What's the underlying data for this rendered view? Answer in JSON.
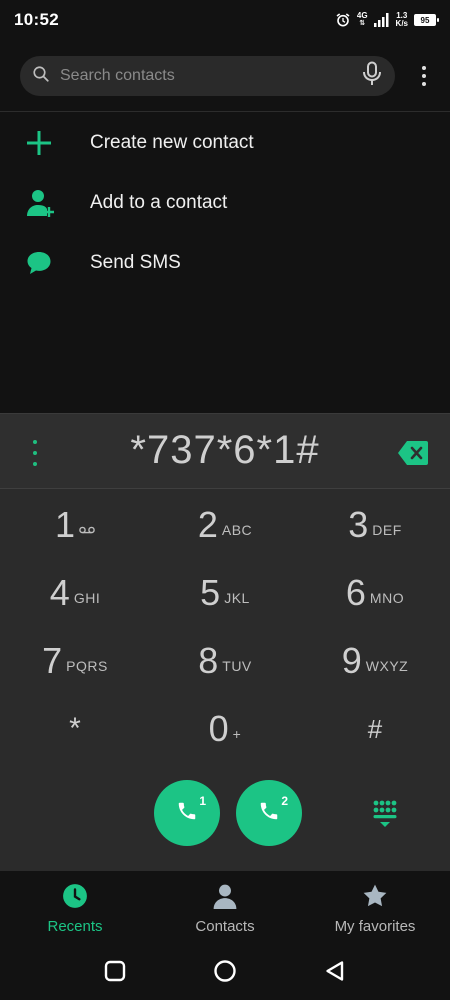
{
  "status_bar": {
    "time": "10:52",
    "network": "4G",
    "speed_value": "1.3",
    "speed_unit": "K/s",
    "battery": "95"
  },
  "search": {
    "placeholder": "Search contacts",
    "icons": {
      "search": "search-icon",
      "mic": "microphone-icon",
      "more": "more-vert-icon"
    }
  },
  "actions": [
    {
      "label": "Create new contact",
      "icon": "plus-icon"
    },
    {
      "label": "Add to a contact",
      "icon": "person-add-icon"
    },
    {
      "label": "Send SMS",
      "icon": "chat-bubble-icon"
    }
  ],
  "dialer": {
    "number": "*737*6*1#",
    "keys": [
      {
        "digit": "1",
        "letters": "voicemail"
      },
      {
        "digit": "2",
        "letters": "ABC"
      },
      {
        "digit": "3",
        "letters": "DEF"
      },
      {
        "digit": "4",
        "letters": "GHI"
      },
      {
        "digit": "5",
        "letters": "JKL"
      },
      {
        "digit": "6",
        "letters": "MNO"
      },
      {
        "digit": "7",
        "letters": "PQRS"
      },
      {
        "digit": "8",
        "letters": "TUV"
      },
      {
        "digit": "9",
        "letters": "WXYZ"
      },
      {
        "digit": "*",
        "letters": ""
      },
      {
        "digit": "0",
        "letters": "+"
      },
      {
        "digit": "#",
        "letters": ""
      }
    ],
    "call_buttons": [
      {
        "sim": "1"
      },
      {
        "sim": "2"
      }
    ]
  },
  "bottom_nav": [
    {
      "label": "Recents",
      "active": true
    },
    {
      "label": "Contacts",
      "active": false
    },
    {
      "label": "My favorites",
      "active": false
    }
  ],
  "colors": {
    "accent": "#1cc485",
    "background": "#121212",
    "dial_background": "#2b2b2b",
    "nav_inactive": "#b8b8b8"
  }
}
